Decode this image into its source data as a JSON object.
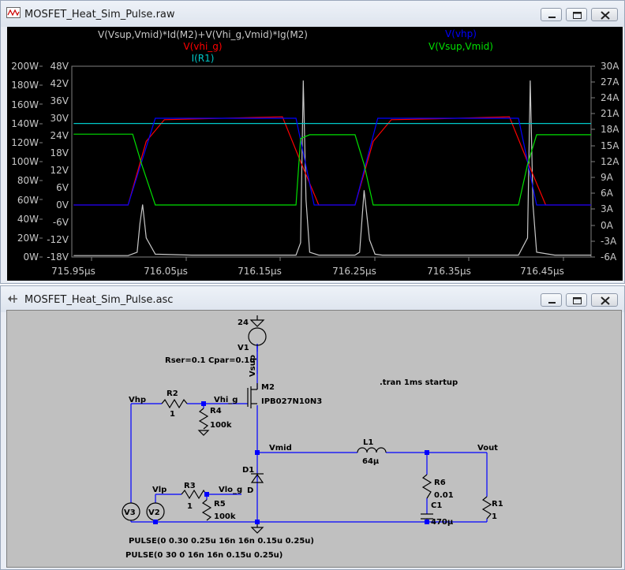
{
  "plot_window": {
    "title": "MOSFET_Heat_Sim_Pulse.raw",
    "traces": [
      {
        "label": "V(Vsup,Vmid)*Id(M2)+V(Vhi_g,Vmid)*Ig(M2)",
        "color": "#c8c8c8"
      },
      {
        "label": "V(vhi_g)",
        "color": "#ff0000"
      },
      {
        "label": "I(R1)",
        "color": "#00c8c8"
      },
      {
        "label": "V(vhp)",
        "color": "#0000ff"
      },
      {
        "label": "V(Vsup,Vmid)",
        "color": "#00e000"
      }
    ],
    "left_axis_outer": [
      "200W",
      "180W",
      "160W",
      "140W",
      "120W",
      "100W",
      "80W",
      "60W",
      "40W",
      "20W",
      "0W"
    ],
    "left_axis_inner": [
      "48V",
      "42V",
      "36V",
      "30V",
      "24V",
      "18V",
      "12V",
      "6V",
      "0V",
      "-6V",
      "-12V",
      "-18V"
    ],
    "right_axis": [
      "30A",
      "27A",
      "24A",
      "21A",
      "18A",
      "15A",
      "12A",
      "9A",
      "6A",
      "3A",
      "0A",
      "-3A",
      "-6A"
    ],
    "x_axis": [
      "715.95µs",
      "716.05µs",
      "716.15µs",
      "716.25µs",
      "716.35µs",
      "716.45µs"
    ]
  },
  "chart_data": {
    "type": "line",
    "x_unit": "µs",
    "xlim": [
      715.928,
      716.5
    ],
    "y_left_outer_lim": [
      0,
      200
    ],
    "y_left_inner_lim": [
      -18,
      48
    ],
    "y_right_lim": [
      -6,
      30
    ],
    "series": [
      {
        "name": "V(Vsup,Vmid)*Id(M2)+V(Vhi_g,Vmid)*Ig(M2)",
        "axis": "W",
        "x": [
          715.93,
          715.99,
          716.0,
          716.003,
          716.006,
          716.01,
          716.02,
          716.06,
          716.175,
          716.18,
          716.183,
          716.186,
          716.19,
          716.2,
          716.24,
          716.245,
          716.25,
          716.256,
          716.262,
          716.27,
          716.35,
          716.42,
          716.43,
          716.433,
          716.436,
          716.44,
          716.46,
          716.5
        ],
        "y": [
          1.5,
          1.5,
          5,
          35,
          55,
          20,
          3,
          2,
          2,
          15,
          185,
          60,
          5,
          2,
          2,
          5,
          70,
          18,
          3,
          2,
          2,
          2,
          20,
          185,
          55,
          5,
          2,
          2
        ]
      },
      {
        "name": "V(vhi_g)",
        "axis": "V",
        "x": [
          715.93,
          715.99,
          716.01,
          716.03,
          716.07,
          716.16,
          716.18,
          716.2,
          716.24,
          716.26,
          716.28,
          716.33,
          716.41,
          716.43,
          716.45,
          716.5
        ],
        "y": [
          0,
          0,
          22,
          29.5,
          29.8,
          30.5,
          15,
          0,
          0,
          22,
          29.5,
          29.8,
          30.5,
          15,
          0,
          0
        ]
      },
      {
        "name": "I(R1)",
        "axis": "A",
        "x": [
          715.93,
          716.5
        ],
        "y": [
          19.2,
          19.2
        ]
      },
      {
        "name": "V(vhp)",
        "axis": "V",
        "x": [
          715.93,
          715.99,
          716.02,
          716.175,
          716.195,
          716.24,
          716.265,
          716.42,
          716.44,
          716.5
        ],
        "y": [
          0,
          0,
          30,
          30,
          0,
          0,
          30,
          30,
          0,
          0
        ]
      },
      {
        "name": "V(Vsup,Vmid)",
        "axis": "V",
        "x": [
          715.93,
          715.995,
          716.005,
          716.02,
          716.17,
          716.175,
          716.18,
          716.19,
          716.24,
          716.25,
          716.26,
          716.42,
          716.43,
          716.44,
          716.5
        ],
        "y": [
          24.5,
          24.5,
          14,
          0,
          0,
          0,
          23,
          24.3,
          24.3,
          14,
          0,
          0,
          14,
          24.3,
          24.3
        ]
      }
    ]
  },
  "schematic_window": {
    "title": "MOSFET_Heat_Sim_Pulse.asc",
    "labels": {
      "v_supply_value": "24",
      "v1": "V1",
      "rser": "Rser=0.1 Cpar=0.1u",
      "vsup": "Vsup",
      "m2": "M2",
      "m2_model": "IPB027N10N3",
      "tran": ".tran 1ms startup",
      "vhp": "Vhp",
      "r2": "R2",
      "r2_val": "1",
      "vhi_g": "Vhi_g",
      "r4": "R4",
      "r4_val": "100k",
      "vmid": "Vmid",
      "l1": "L1",
      "l1_val": "64µ",
      "vout": "Vout",
      "d1": "D1",
      "d_model": "D",
      "r6": "R6",
      "r6_val": "0.01",
      "c1": "C1",
      "c1_val": "470µ",
      "r1": "R1",
      "r1_val": "1",
      "vlp": "Vlp",
      "r3": "R3",
      "r3_val": "1",
      "vlo_g": "Vlo_g",
      "r5": "R5",
      "r5_val": "100k",
      "v3": "V3",
      "v2": "V2",
      "pulse1": "PULSE(0 0.30 0.25u 16n 16n 0.15u 0.25u)",
      "pulse2": "PULSE(0 30 0 16n 16n 0.15u 0.25u)"
    }
  }
}
